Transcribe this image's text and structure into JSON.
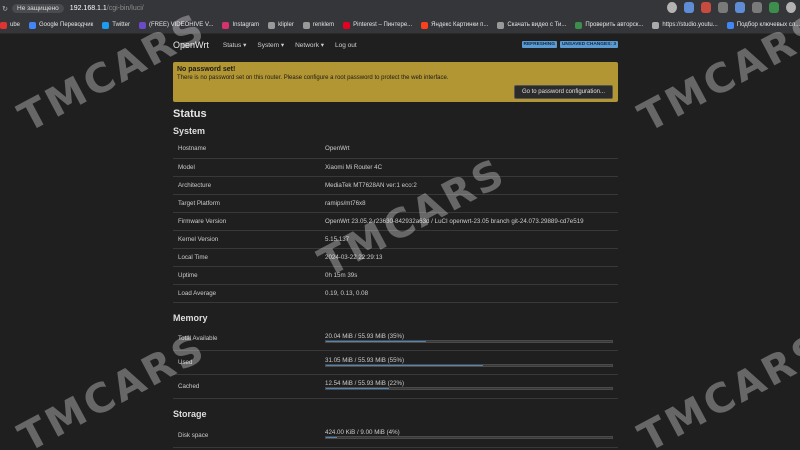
{
  "browser": {
    "insecure_label": "Не защищено",
    "url_host": "192.168.1.1",
    "url_path": "/cgi-bin/luci/"
  },
  "bookmarks": [
    {
      "label": "ube",
      "color": "#d33"
    },
    {
      "label": "Google Переводчик",
      "color": "#4285f4"
    },
    {
      "label": "Twitter",
      "color": "#1d9bf0"
    },
    {
      "label": "(FREE) VIDEOHIVE V...",
      "color": "#6b49c7"
    },
    {
      "label": "Instagram",
      "color": "#d6336c"
    },
    {
      "label": "klipler",
      "color": "#999"
    },
    {
      "label": "renklem",
      "color": "#999"
    },
    {
      "label": "Pinterest – Пинтере...",
      "color": "#e60023"
    },
    {
      "label": "Яндекс Картинки п...",
      "color": "#fc3f1d"
    },
    {
      "label": "Скачать видео с Ти...",
      "color": "#999"
    },
    {
      "label": "Проверить авторск...",
      "color": "#3d8d4c"
    },
    {
      "label": "https://studio.youtu...",
      "color": "#aaa"
    },
    {
      "label": "Подбор ключевых сл...",
      "color": "#4285f4"
    }
  ],
  "openwrt": {
    "brand": "OpenWrt",
    "nav": [
      "Status ▾",
      "System ▾",
      "Network ▾",
      "Log out"
    ],
    "badge_refresh": "REFRESHING",
    "badge_unsaved": "UNSAVED CHANGES: 3"
  },
  "warning": {
    "title": "No password set!",
    "text": "There is no password set on this router. Please configure a root password to protect the web interface.",
    "button": "Go to password configuration..."
  },
  "page_title": "Status",
  "system": {
    "heading": "System",
    "rows": [
      {
        "k": "Hostname",
        "v": "OpenWrt"
      },
      {
        "k": "Model",
        "v": "Xiaomi Mi Router 4C"
      },
      {
        "k": "Architecture",
        "v": "MediaTek MT7628AN ver:1 eco:2"
      },
      {
        "k": "Target Platform",
        "v": "ramips/mt76x8"
      },
      {
        "k": "Firmware Version",
        "v": "OpenWrt 23.05.2 r23630-842932a63d / LuCI openwrt-23.05 branch git-24.073.29889-cd7e519"
      },
      {
        "k": "Kernel Version",
        "v": "5.15.137"
      },
      {
        "k": "Local Time",
        "v": "2024-03-22 22:29:13"
      },
      {
        "k": "Uptime",
        "v": "0h 15m 39s"
      },
      {
        "k": "Load Average",
        "v": "0.19, 0.13, 0.08"
      }
    ]
  },
  "memory": {
    "heading": "Memory",
    "rows": [
      {
        "k": "Total Available",
        "v": "20.04 MiB / 55.93 MiB (35%)",
        "pct": 0.35
      },
      {
        "k": "Used",
        "v": "31.05 MiB / 55.93 MiB (55%)",
        "pct": 0.55
      },
      {
        "k": "Cached",
        "v": "12.54 MiB / 55.93 MiB (22%)",
        "pct": 0.22
      }
    ]
  },
  "storage": {
    "heading": "Storage",
    "rows": [
      {
        "k": "Disk space",
        "v": "424.00 KiB / 9.00 MiB (4%)",
        "pct": 0.04
      }
    ]
  },
  "watermark": "TMCARS"
}
